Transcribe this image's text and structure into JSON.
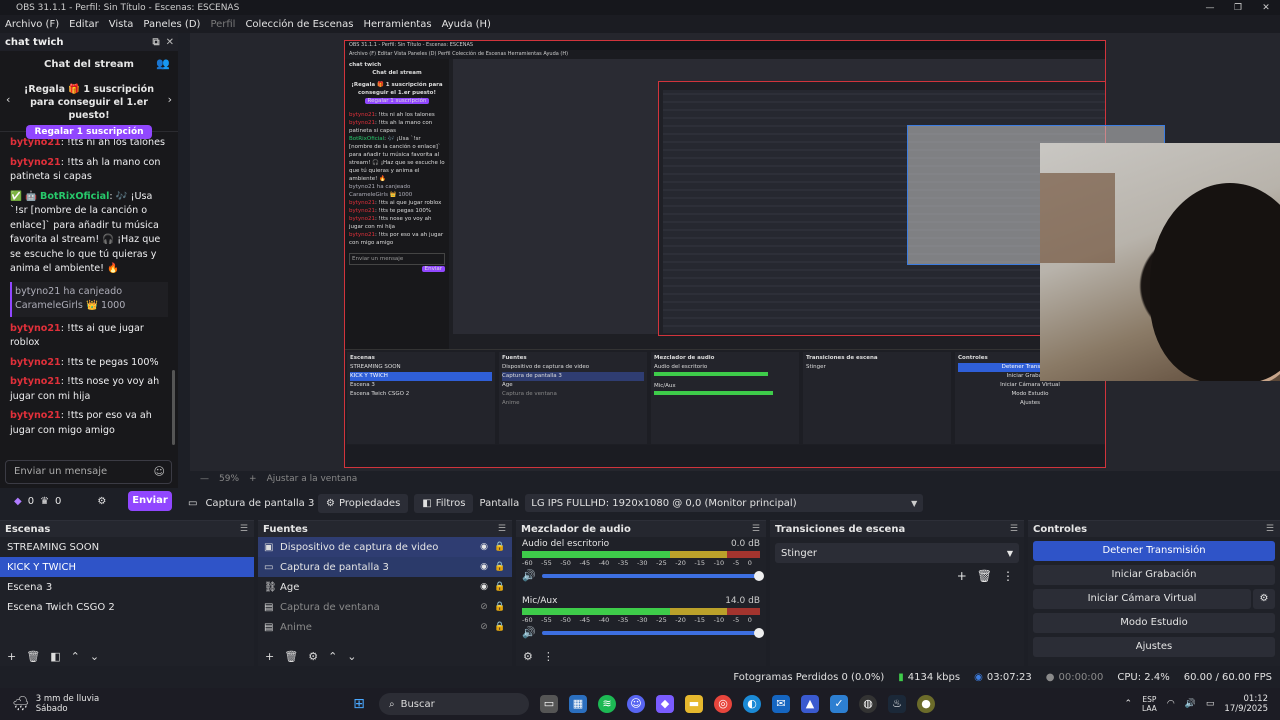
{
  "window": {
    "title": "OBS 31.1.1 - Perfil: Sin Título - Escenas: ESCENAS",
    "controls": [
      "—",
      "❐",
      "✕"
    ]
  },
  "menu": [
    "Archivo (F)",
    "Editar",
    "Vista",
    "Paneles (D)",
    "Perfil",
    "Colección de Escenas",
    "Herramientas",
    "Ayuda (H)"
  ],
  "chat": {
    "dock_title": "chat twich",
    "header": "Chat del stream",
    "promo_text": "¡Regala 🎁 1 suscripción para conseguir el 1.er puesto!",
    "promo_button": "Regalar 1 suscripción",
    "messages": [
      {
        "user": "bytyno21",
        "text": ": !tts ni ah los talones"
      },
      {
        "user": "bytyno21",
        "text": ": !tts ah la mano con patineta si capas"
      },
      {
        "user": "BotRixOficial",
        "badge": "✅ 🤖",
        "text": ": 🎶 ¡Usa `!sr [nombre de la canción o enlace]` para añadir tu música favorita al stream! 🎧 ¡Haz que se escuche lo que tú quieras y anima el ambiente! 🔥"
      },
      {
        "system": "bytyno21 ha canjeado CarameleGirls 👑 1000"
      },
      {
        "user": "bytyno21",
        "text": ": !tts ai que jugar roblox"
      },
      {
        "user": "bytyno21",
        "text": ": !tts te pegas 100%"
      },
      {
        "user": "bytyno21",
        "text": ": !tts nose yo voy ah jugar con mi hija"
      },
      {
        "user": "bytyno21",
        "text": ": !tts por eso va ah jugar con migo amigo"
      }
    ],
    "input_placeholder": "Enviar un mensaje",
    "bits": "0",
    "points": "0",
    "send": "Enviar"
  },
  "preview": {
    "zoom": "59%",
    "fit_label": "Ajustar a la ventana"
  },
  "toolbar": {
    "source_name": "Captura de pantalla 3",
    "properties": "Propiedades",
    "filters": "Filtros",
    "display_label": "Pantalla",
    "display_value": "LG IPS FULLHD: 1920x1080 @ 0,0 (Monitor principal)"
  },
  "scenes": {
    "title": "Escenas",
    "items": [
      "STREAMING SOON",
      "KICK Y TWICH",
      "Escena 3",
      "Escena Twich CSGO 2"
    ],
    "selected": 1
  },
  "sources": {
    "title": "Fuentes",
    "items": [
      {
        "name": "Dispositivo de captura de video",
        "icon": "camera-icon",
        "visible": true
      },
      {
        "name": "Captura de pantalla 3",
        "icon": "monitor-icon",
        "visible": true
      },
      {
        "name": "Age",
        "icon": "link-icon",
        "visible": true
      },
      {
        "name": "Captura de ventana",
        "icon": "window-icon",
        "visible": false
      },
      {
        "name": "Anime",
        "icon": "window-icon",
        "visible": false
      }
    ]
  },
  "mixer": {
    "title": "Mezclador de audio",
    "channels": [
      {
        "name": "Audio del escritorio",
        "db": "0.0 dB",
        "level": 0.62
      },
      {
        "name": "Mic/Aux",
        "db": "14.0 dB",
        "level": 0.7
      }
    ],
    "scale": [
      "-60",
      "-55",
      "-50",
      "-45",
      "-40",
      "-35",
      "-30",
      "-25",
      "-20",
      "-15",
      "-10",
      "-5",
      "0"
    ]
  },
  "transitions": {
    "title": "Transiciones de escena",
    "selected": "Stinger"
  },
  "controls": {
    "title": "Controles",
    "buttons": [
      "Detener Transmisión",
      "Iniciar Grabación",
      "Iniciar Cámara Virtual",
      "Modo Estudio",
      "Ajustes"
    ]
  },
  "status": {
    "dropped": "Fotogramas Perdidos 0 (0.0%)",
    "bitrate": "4134 kbps",
    "stream_time": "03:07:23",
    "rec_time": "00:00:00",
    "cpu": "CPU: 2.4%",
    "fps": "60.00 / 60.00 FPS"
  },
  "taskbar": {
    "weather_temp": "3 mm de lluvia",
    "weather_day": "Sábado",
    "search": "Buscar",
    "lang_1": "ESP",
    "lang_2": "LAA",
    "time": "01:12",
    "date": "17/9/2025"
  },
  "nested": {
    "title": "OBS 31.1.1 - Perfil: Sin Título - Escenas: ESCENAS",
    "menu": "Archivo (F)   Editar   Vista   Paneles (D)   Perfil   Colección de Escenas   Herramientas   Ayuda (H)",
    "scenes_title": "Escenas",
    "sources_title": "Fuentes",
    "mixer_title": "Mezclador de audio",
    "transitions_title": "Transiciones de escena",
    "controls_title": "Controles"
  },
  "colors": {
    "accent": "#2f54c8",
    "twitch": "#9147ff",
    "record_border": "#d1343c"
  }
}
